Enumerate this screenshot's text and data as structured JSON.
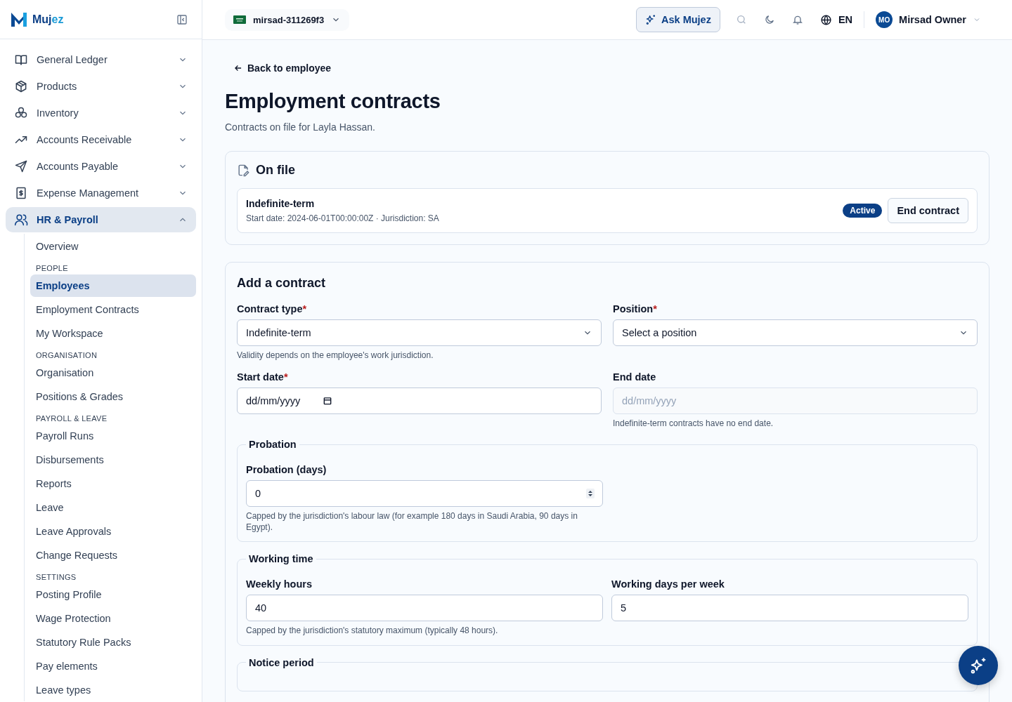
{
  "brand": {
    "name_a": "Mu",
    "name_b": "j",
    "name_c": "ez"
  },
  "sidebar": {
    "nav": [
      {
        "label": "General Ledger",
        "expanded": false,
        "selected": false
      },
      {
        "label": "Products",
        "expanded": false,
        "selected": false
      },
      {
        "label": "Inventory",
        "expanded": false,
        "selected": false
      },
      {
        "label": "Accounts Receivable",
        "expanded": false,
        "selected": false
      },
      {
        "label": "Accounts Payable",
        "expanded": false,
        "selected": false
      },
      {
        "label": "Expense Management",
        "expanded": false,
        "selected": false
      },
      {
        "label": "HR & Payroll",
        "expanded": true,
        "selected": true,
        "children": [
          {
            "kind": "link",
            "label": "Overview",
            "selected": false
          },
          {
            "kind": "section",
            "label": "PEOPLE"
          },
          {
            "kind": "link",
            "label": "Employees",
            "selected": true
          },
          {
            "kind": "link",
            "label": "Employment Contracts",
            "selected": false
          },
          {
            "kind": "link",
            "label": "My Workspace",
            "selected": false
          },
          {
            "kind": "section",
            "label": "ORGANISATION"
          },
          {
            "kind": "link",
            "label": "Organisation",
            "selected": false
          },
          {
            "kind": "link",
            "label": "Positions & Grades",
            "selected": false
          },
          {
            "kind": "section",
            "label": "PAYROLL & LEAVE"
          },
          {
            "kind": "link",
            "label": "Payroll Runs",
            "selected": false
          },
          {
            "kind": "link",
            "label": "Disbursements",
            "selected": false
          },
          {
            "kind": "link",
            "label": "Reports",
            "selected": false
          },
          {
            "kind": "link",
            "label": "Leave",
            "selected": false
          },
          {
            "kind": "link",
            "label": "Leave Approvals",
            "selected": false
          },
          {
            "kind": "link",
            "label": "Change Requests",
            "selected": false
          },
          {
            "kind": "section",
            "label": "SETTINGS"
          },
          {
            "kind": "link",
            "label": "Posting Profile",
            "selected": false
          },
          {
            "kind": "link",
            "label": "Wage Protection",
            "selected": false
          },
          {
            "kind": "link",
            "label": "Statutory Rule Packs",
            "selected": false
          },
          {
            "kind": "link",
            "label": "Pay elements",
            "selected": false
          },
          {
            "kind": "link",
            "label": "Leave types",
            "selected": false
          }
        ]
      }
    ]
  },
  "topbar": {
    "org": "mirsad-311269f3",
    "ask": "Ask Mujez",
    "language": "EN",
    "avatar": "MO",
    "user": "Mirsad Owner"
  },
  "back_link": "Back to employee",
  "title": "Employment contracts",
  "subtitle": "Contracts on file for Layla Hassan.",
  "on_file": {
    "heading": "On file",
    "contracts": [
      {
        "title": "Indefinite-term",
        "meta": "Start date: 2024-06-01T00:00:00Z · Jurisdiction: SA",
        "status": "Active",
        "action": "End contract"
      }
    ]
  },
  "add_contract": {
    "heading": "Add a contract",
    "rows": [
      [
        {
          "kind": "select",
          "label": "Contract type",
          "required": true,
          "value": "Indefinite-term",
          "hint": "Validity depends on the employee's work jurisdiction.",
          "disabled": false
        },
        {
          "kind": "select",
          "label": "Position",
          "required": true,
          "value": "Select a position",
          "disabled": false
        }
      ],
      [
        {
          "kind": "date",
          "label": "Start date",
          "required": true,
          "placeholder": "dd/mm/yyyy",
          "disabled": false
        },
        {
          "kind": "text",
          "label": "End date",
          "required": false,
          "placeholder": "dd/mm/yyyy",
          "hint": "Indefinite-term contracts have no end date.",
          "disabled": true
        }
      ]
    ],
    "groups": [
      {
        "legend": "Probation",
        "fields": [
          {
            "kind": "number",
            "label": "Probation (days)",
            "required": false,
            "value": "0",
            "hint": "Capped by the jurisdiction's labour law (for example 180 days in Saudi Arabia, 90 days in Egypt).",
            "disabled": false
          }
        ]
      },
      {
        "legend": "Working time",
        "fields": [
          {
            "kind": "text",
            "label": "Weekly hours",
            "required": false,
            "value": "40",
            "hint": "Capped by the jurisdiction's statutory maximum (typically 48 hours).",
            "disabled": false
          },
          {
            "kind": "text",
            "label": "Working days per week",
            "required": false,
            "value": "5",
            "disabled": false
          }
        ]
      },
      {
        "legend": "Notice period"
      }
    ],
    "required_mark": "*"
  }
}
